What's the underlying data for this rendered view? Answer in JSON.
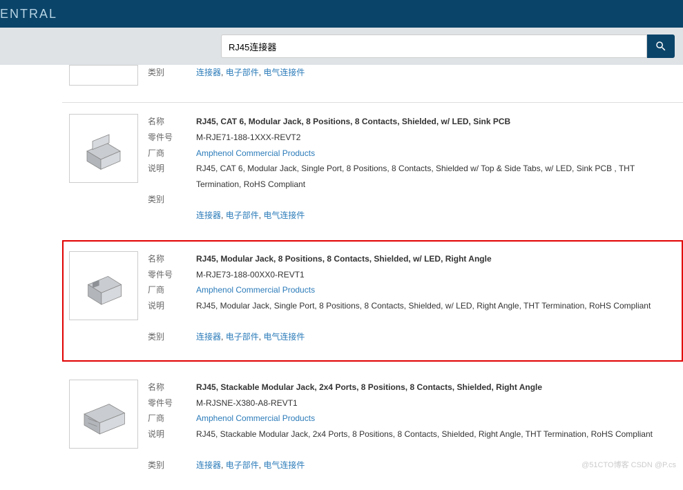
{
  "header": {
    "title": "ENTRAL"
  },
  "search": {
    "value": "RJ45连接器"
  },
  "labels": {
    "name": "名称",
    "part": "零件号",
    "mfr": "厂商",
    "desc": "说明",
    "cat": "类别"
  },
  "cats": [
    "连接器",
    "电子部件",
    "电气连接件"
  ],
  "mfr_link": "Amphenol Commercial Products",
  "items": [
    {
      "name": "RJ45, CAT 6, Modular Jack, 8 Positions, 8 Contacts, Shielded, w/ LED, Sink PCB",
      "part": "M-RJE71-188-1XXX-REVT2",
      "desc": "RJ45, CAT 6, Modular Jack, Single Port, 8 Positions, 8 Contacts, Shielded w/ Top & Side Tabs, w/ LED, Sink PCB , THT Termination, RoHS Compliant"
    },
    {
      "name": "RJ45, Modular Jack, 8 Positions, 8 Contacts, Shielded, w/ LED, Right Angle",
      "part": "M-RJE73-188-00XX0-REVT1",
      "desc": "RJ45, Modular Jack, Single Port, 8 Positions, 8 Contacts, Shielded, w/ LED, Right Angle, THT Termination, RoHS Compliant",
      "highlight": true
    },
    {
      "name": "RJ45, Stackable Modular Jack, 2x4 Ports, 8 Positions, 8 Contacts, Shielded, Right Angle",
      "part": "M-RJSNE-X380-A8-REVT1",
      "desc": "RJ45, Stackable Modular Jack, 2x4 Ports, 8 Positions, 8 Contacts, Shielded, Right Angle, THT Termination, RoHS Compliant"
    }
  ],
  "watermark": "@51CTO博客  CSDN @P.cs"
}
